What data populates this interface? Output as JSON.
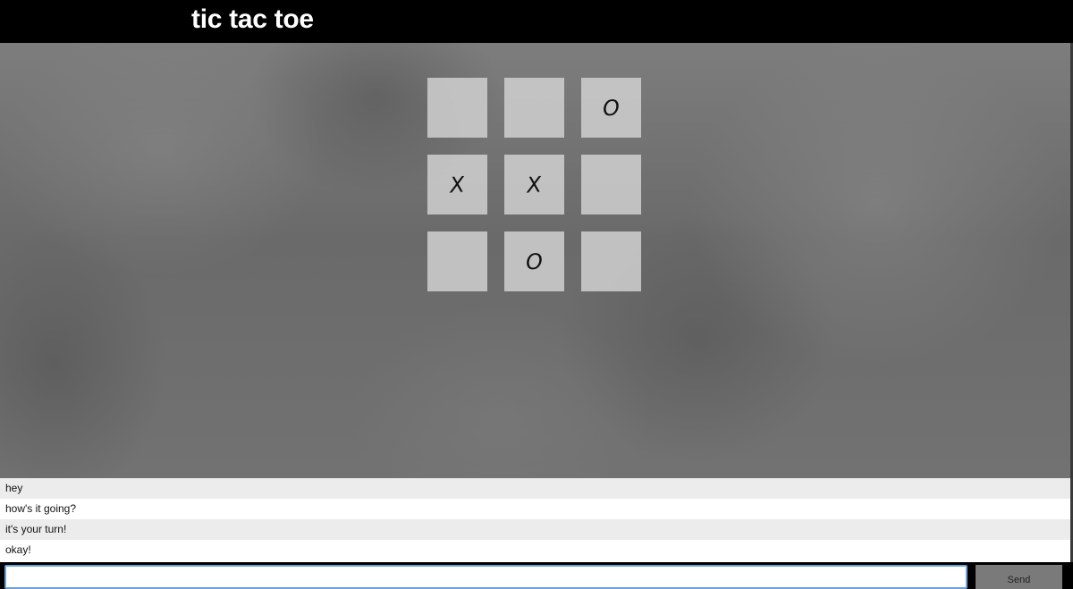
{
  "header": {
    "title": "tic tac toe"
  },
  "board": {
    "cells": [
      "",
      "",
      "O",
      "X",
      "X",
      "",
      "",
      "O",
      ""
    ]
  },
  "chat": {
    "messages": [
      "hey",
      "how's it going?",
      "it's your turn!",
      "okay!"
    ],
    "input_value": "",
    "send_label": "Send"
  }
}
